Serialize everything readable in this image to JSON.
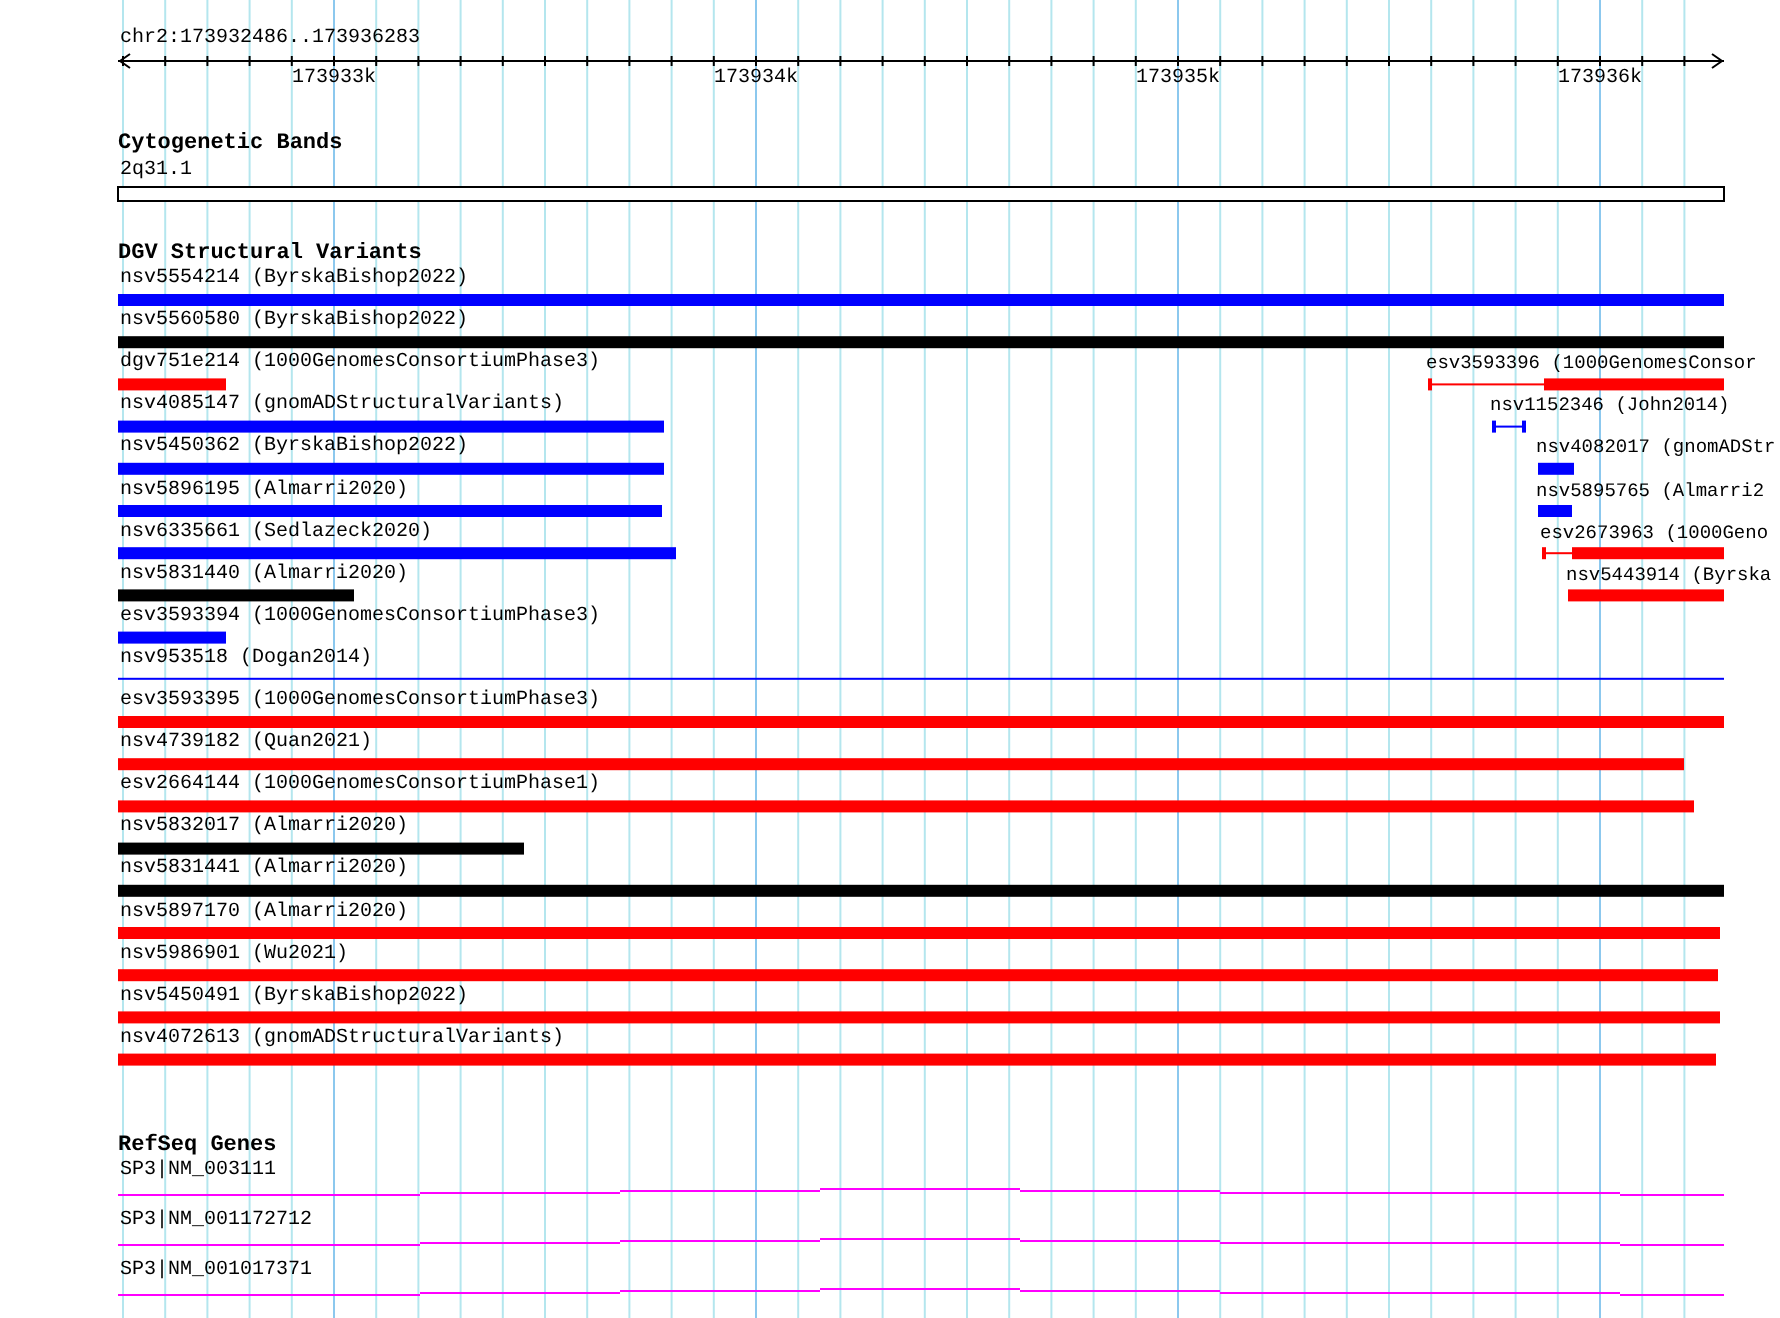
{
  "ruler": {
    "location": "chr2:173932486..173936283",
    "ticks": [
      {
        "label": "173933k"
      },
      {
        "label": "173934k"
      },
      {
        "label": "173935k"
      },
      {
        "label": "173936k"
      }
    ]
  },
  "cytogenetic_bands": {
    "title": "Cytogenetic Bands",
    "features": [
      {
        "label": "2q31.1"
      }
    ]
  },
  "dgv": {
    "title": "DGV Structural Variants",
    "rows": [
      {
        "features": [
          {
            "label": "nsv5554214 (ByrskaBishop2022)",
            "color": "#0000ff",
            "kind": "bar"
          }
        ]
      },
      {
        "features": [
          {
            "label": "nsv5560580 (ByrskaBishop2022)",
            "color": "#000000",
            "kind": "bar"
          }
        ]
      },
      {
        "features": [
          {
            "label": "dgv751e214 (1000GenomesConsortiumPhase3)",
            "color": "#ff0000",
            "kind": "bar"
          },
          {
            "label": "esv3593396 (1000GenomesConsor",
            "color": "#ff0000",
            "kind": "capped"
          }
        ]
      },
      {
        "features": [
          {
            "label": "nsv4085147 (gnomADStructuralVariants)",
            "color": "#0000ff",
            "kind": "bar"
          },
          {
            "label": "nsv1152346 (John2014)",
            "color": "#0000ff",
            "kind": "capped"
          }
        ]
      },
      {
        "features": [
          {
            "label": "nsv5450362 (ByrskaBishop2022)",
            "color": "#0000ff",
            "kind": "bar"
          },
          {
            "label": "nsv4082017 (gnomADStr",
            "color": "#0000ff",
            "kind": "bar"
          }
        ]
      },
      {
        "features": [
          {
            "label": "nsv5896195 (Almarri2020)",
            "color": "#0000ff",
            "kind": "bar"
          },
          {
            "label": "nsv5895765 (Almarri2",
            "color": "#0000ff",
            "kind": "bar"
          }
        ]
      },
      {
        "features": [
          {
            "label": "nsv6335661 (Sedlazeck2020)",
            "color": "#0000ff",
            "kind": "bar"
          },
          {
            "label": "esv2673963 (1000Geno",
            "color": "#ff0000",
            "kind": "capped"
          }
        ]
      },
      {
        "features": [
          {
            "label": "nsv5831440 (Almarri2020)",
            "color": "#000000",
            "kind": "bar"
          },
          {
            "label": "nsv5443914 (Byrska",
            "color": "#ff0000",
            "kind": "bar"
          }
        ]
      },
      {
        "features": [
          {
            "label": "esv3593394 (1000GenomesConsortiumPhase3)",
            "color": "#0000ff",
            "kind": "bar"
          }
        ]
      },
      {
        "features": [
          {
            "label": "nsv953518 (Dogan2014)",
            "color": "#0000ff",
            "kind": "line"
          }
        ]
      },
      {
        "features": [
          {
            "label": "esv3593395 (1000GenomesConsortiumPhase3)",
            "color": "#ff0000",
            "kind": "bar"
          }
        ]
      },
      {
        "features": [
          {
            "label": "nsv4739182 (Quan2021)",
            "color": "#ff0000",
            "kind": "bar"
          }
        ]
      },
      {
        "features": [
          {
            "label": "esv2664144 (1000GenomesConsortiumPhase1)",
            "color": "#ff0000",
            "kind": "bar"
          }
        ]
      },
      {
        "features": [
          {
            "label": "nsv5832017 (Almarri2020)",
            "color": "#000000",
            "kind": "bar"
          }
        ]
      },
      {
        "features": [
          {
            "label": "nsv5831441 (Almarri2020)",
            "color": "#000000",
            "kind": "bar"
          }
        ]
      },
      {
        "features": [
          {
            "label": "nsv5897170 (Almarri2020)",
            "color": "#ff0000",
            "kind": "bar"
          }
        ]
      },
      {
        "features": [
          {
            "label": "nsv5986901 (Wu2021)",
            "color": "#ff0000",
            "kind": "bar"
          }
        ]
      },
      {
        "features": [
          {
            "label": "nsv5450491 (ByrskaBishop2022)",
            "color": "#ff0000",
            "kind": "bar"
          }
        ]
      },
      {
        "features": [
          {
            "label": "nsv4072613 (gnomADStructuralVariants)",
            "color": "#ff0000",
            "kind": "bar"
          }
        ]
      }
    ]
  },
  "refseq_genes": {
    "title": "RefSeq Genes",
    "transcripts": [
      {
        "label": "SP3|NM_003111"
      },
      {
        "label": "SP3|NM_001172712"
      },
      {
        "label": "SP3|NM_001017371"
      }
    ]
  }
}
